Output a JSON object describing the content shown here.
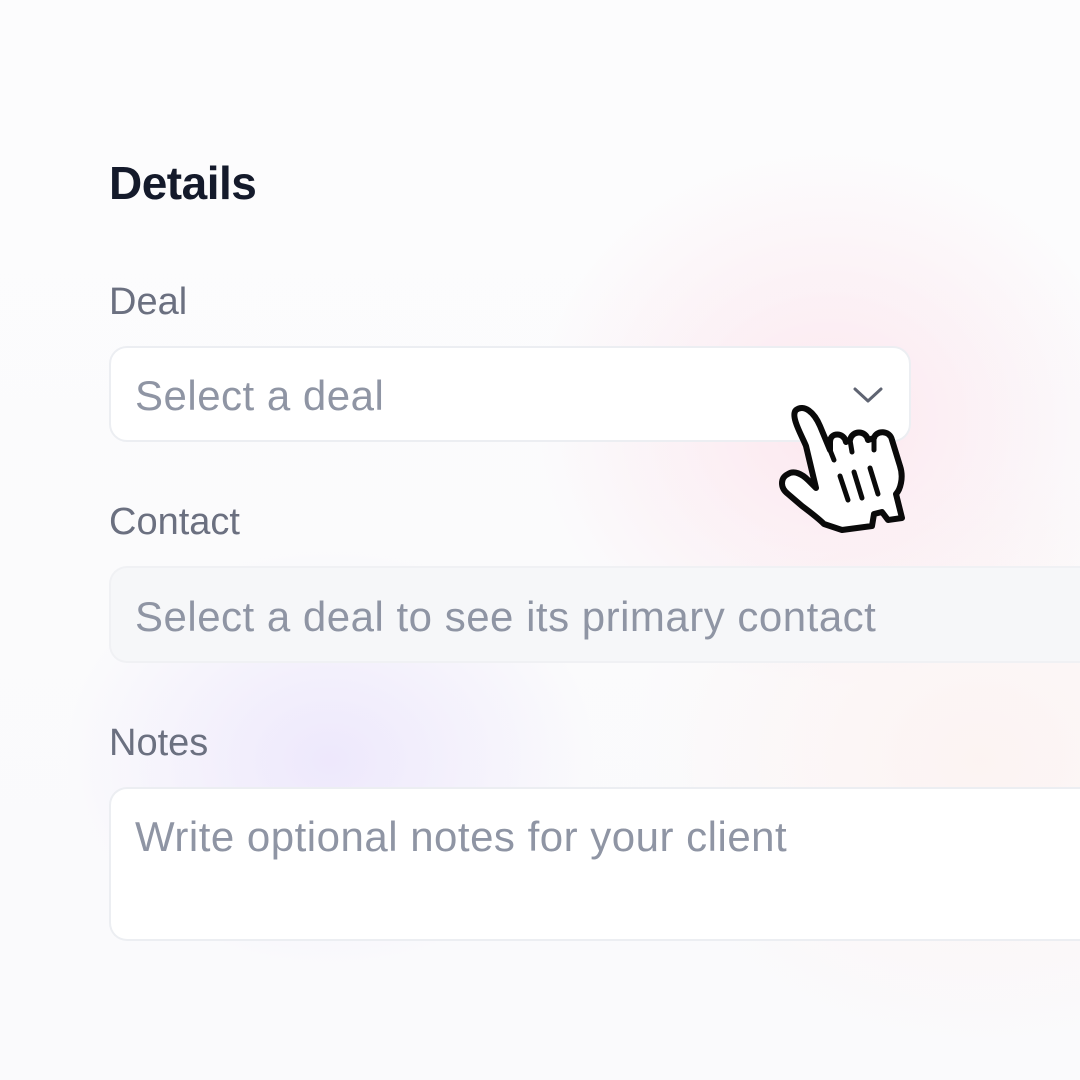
{
  "details": {
    "title": "Details"
  },
  "fields": {
    "deal": {
      "label": "Deal",
      "placeholder": "Select a deal",
      "chevron_icon": "chevron-down"
    },
    "contact": {
      "label": "Contact",
      "placeholder": "Select a deal to see its primary contact"
    },
    "notes": {
      "label": "Notes",
      "placeholder": "Write optional notes for your client"
    }
  },
  "cursor": {
    "icon": "hand-pointer-cursor"
  },
  "colors": {
    "title": "#141a2b",
    "label": "#6b7080",
    "placeholder": "#8f95a4",
    "border": "#eceef2",
    "disabled_bg": "#f6f7f9"
  }
}
